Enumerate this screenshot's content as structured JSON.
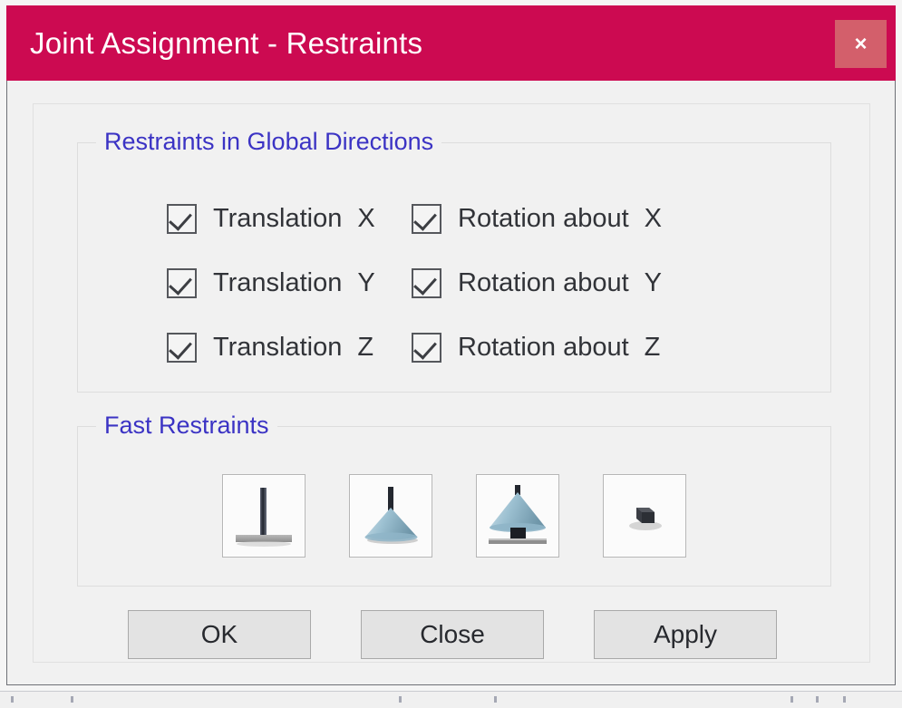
{
  "window": {
    "title": "Joint Assignment - Restraints",
    "close_label": "×",
    "titlebar_color": "#cc0a51",
    "close_button_color": "#d35f6b",
    "legend_color": "#3b33c4"
  },
  "groups": {
    "global": {
      "legend": "Restraints in Global Directions",
      "rows": [
        {
          "left": {
            "label": "Translation",
            "axis": "X",
            "checked": true
          },
          "right": {
            "label": "Rotation about",
            "axis": "X",
            "checked": true
          }
        },
        {
          "left": {
            "label": "Translation",
            "axis": "Y",
            "checked": true
          },
          "right": {
            "label": "Rotation about",
            "axis": "Y",
            "checked": true
          }
        },
        {
          "left": {
            "label": "Translation",
            "axis": "Z",
            "checked": true
          },
          "right": {
            "label": "Rotation about",
            "axis": "Z",
            "checked": true
          }
        }
      ]
    },
    "fast": {
      "legend": "Fast Restraints",
      "buttons": [
        {
          "icon": "fixed-support-icon"
        },
        {
          "icon": "pinned-support-icon"
        },
        {
          "icon": "roller-support-icon"
        },
        {
          "icon": "free-no-restraint-icon"
        }
      ]
    }
  },
  "actions": {
    "ok": "OK",
    "close": "Close",
    "apply": "Apply"
  }
}
